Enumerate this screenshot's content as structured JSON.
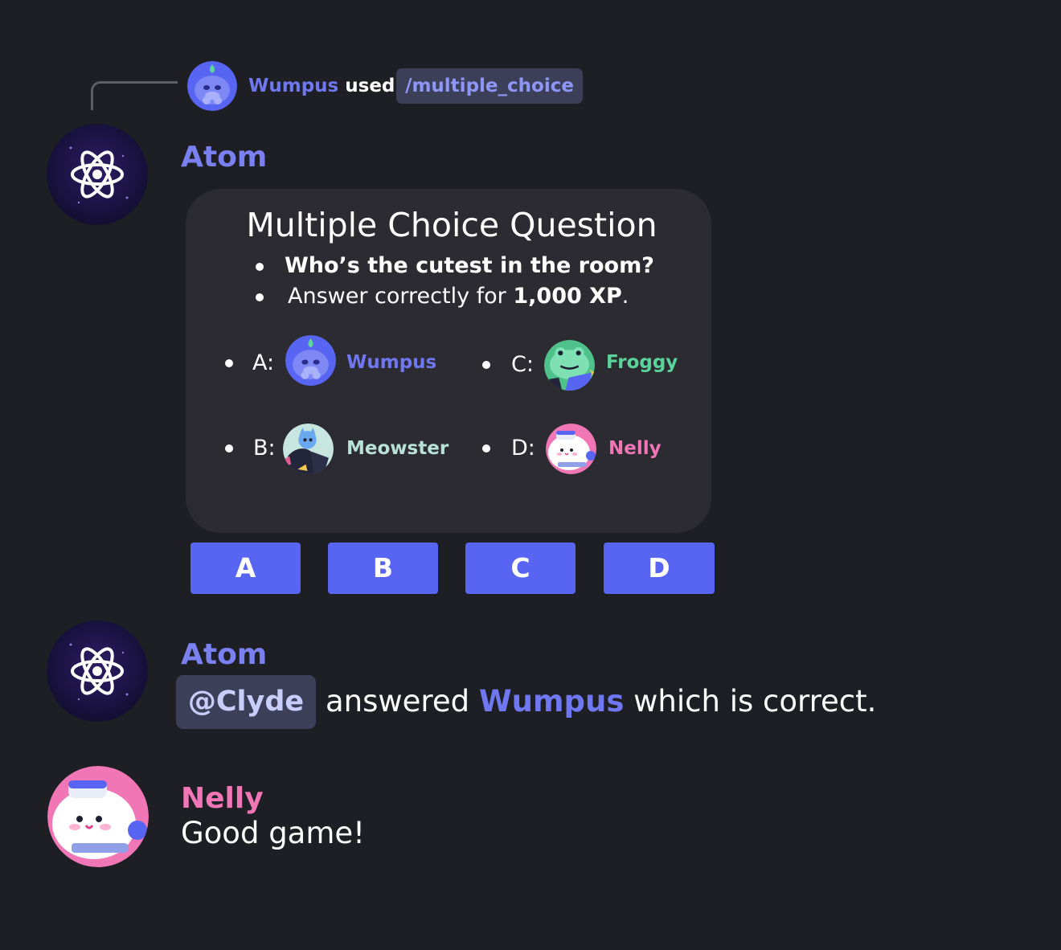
{
  "colors": {
    "background": "#1e1f24",
    "card": "#2c2b31",
    "blurple": "#5865f2",
    "atom_name": "#7a80f0",
    "wumpus": "#6f77f2",
    "froggy": "#5bd49b",
    "meowster": "#b9e2d6",
    "nelly": "#f176b6",
    "mention_bg": "#3c3f58"
  },
  "reply": {
    "user": "Wumpus",
    "verb": "used",
    "command": "/multiple_choice",
    "avatar_icon": "wumpus-avatar-icon"
  },
  "messages": [
    {
      "author": "Atom",
      "avatar_icon": "atom-icon",
      "card": {
        "title": "Multiple Choice Question",
        "question": "Who’s the cutest in the room?",
        "prompt_prefix": "Answer correctly for",
        "prompt_value": "1,000 XP",
        "prompt_suffix": ".",
        "options": [
          {
            "label": "A:",
            "name": "Wumpus",
            "avatar_icon": "wumpus-avatar-icon"
          },
          {
            "label": "B:",
            "name": "Meowster",
            "avatar_icon": "meowster-avatar-icon"
          },
          {
            "label": "C:",
            "name": "Froggy",
            "avatar_icon": "froggy-avatar-icon"
          },
          {
            "label": "D:",
            "name": "Nelly",
            "avatar_icon": "nelly-avatar-icon"
          }
        ]
      },
      "buttons": [
        "A",
        "B",
        "C",
        "D"
      ]
    },
    {
      "author": "Atom",
      "avatar_icon": "atom-icon",
      "mention": "@Clyde",
      "text_before": "answered",
      "highlight": "Wumpus",
      "text_after": "which is correct."
    },
    {
      "author": "Nelly",
      "avatar_icon": "nelly-avatar-icon",
      "text": "Good game!"
    }
  ]
}
